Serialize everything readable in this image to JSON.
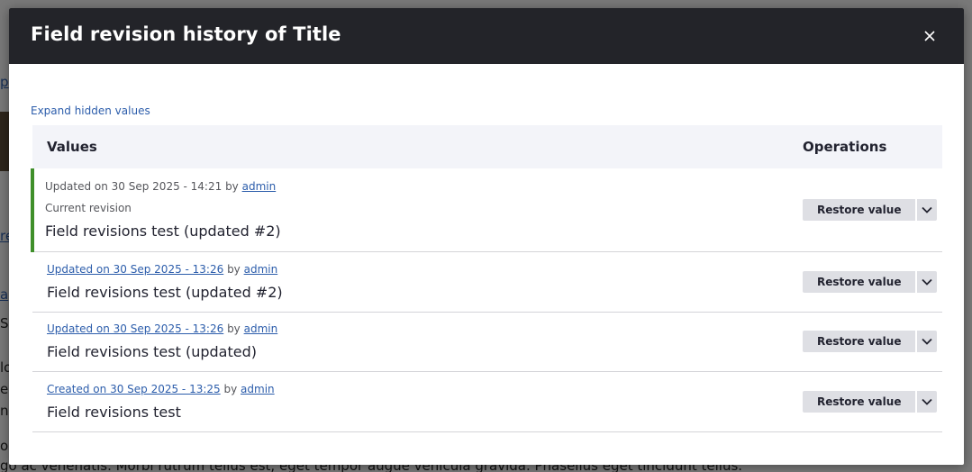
{
  "background": {
    "fragments": [
      "p",
      "re",
      "a",
      "S",
      "lo",
      "ec",
      "ns",
      "o"
    ],
    "bottom_text": "go ac venenatis. Morbi rutrum tellus est, eget tempor augue vehicula gravida. Phasellus eget tincidunt tellus."
  },
  "dialog": {
    "title": "Field revision history of Title",
    "close_icon": "close-icon",
    "expand_label": "Expand hidden values",
    "columns": {
      "values": "Values",
      "operations": "Operations"
    },
    "rows": [
      {
        "meta_prefix": "Updated on 30 Sep 2025 - 14:21",
        "meta_by": " by ",
        "meta_user": "admin",
        "current_label": "Current revision",
        "value": "Field revisions test (updated #2)",
        "restore_label": "Restore value"
      },
      {
        "meta_prefix": "Updated on 30 Sep 2025 - 13:26",
        "meta_by": " by ",
        "meta_user": "admin",
        "value": "Field revisions test (updated #2)",
        "restore_label": "Restore value"
      },
      {
        "meta_prefix": "Updated on 30 Sep 2025 - 13:26",
        "meta_by": " by ",
        "meta_user": "admin",
        "value": "Field revisions test (updated)",
        "restore_label": "Restore value"
      },
      {
        "meta_prefix": "Created on 30 Sep 2025 - 13:25",
        "meta_by": " by ",
        "meta_user": "admin",
        "value": "Field revisions test",
        "restore_label": "Restore value"
      }
    ]
  },
  "colors": {
    "header_bg": "#232429",
    "link": "#2c5dab",
    "current_marker": "#3f8f2a",
    "button_bg": "#dedfe4"
  }
}
